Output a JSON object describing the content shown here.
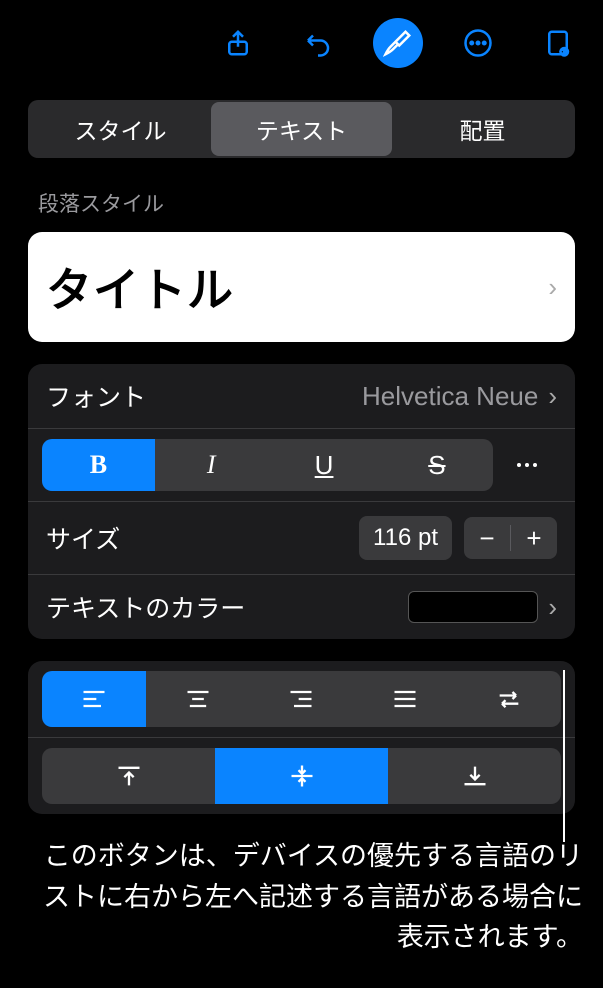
{
  "toolbar": {
    "buttons": [
      "share",
      "undo",
      "format",
      "more",
      "document-settings"
    ],
    "active": "format"
  },
  "tabs": {
    "items": [
      "スタイル",
      "テキスト",
      "配置"
    ],
    "active": 1
  },
  "paragraphStyle": {
    "label": "段落スタイル",
    "value": "タイトル"
  },
  "font": {
    "label": "フォント",
    "value": "Helvetica Neue"
  },
  "style": {
    "bold": "B",
    "italic": "I",
    "underline": "U",
    "strike": "S",
    "boldActive": true
  },
  "size": {
    "label": "サイズ",
    "value": "116 pt"
  },
  "textColor": {
    "label": "テキストのカラー",
    "value": "#000000"
  },
  "alignment": {
    "horiz": [
      "left",
      "center",
      "right",
      "justify",
      "rtl"
    ],
    "horizActive": 0,
    "vert": [
      "top",
      "middle",
      "bottom"
    ],
    "vertActive": 1
  },
  "callout": {
    "text": "このボタンは、デバイスの優先する言語のリストに右から左へ記述する言語がある場合に表示されます。"
  }
}
